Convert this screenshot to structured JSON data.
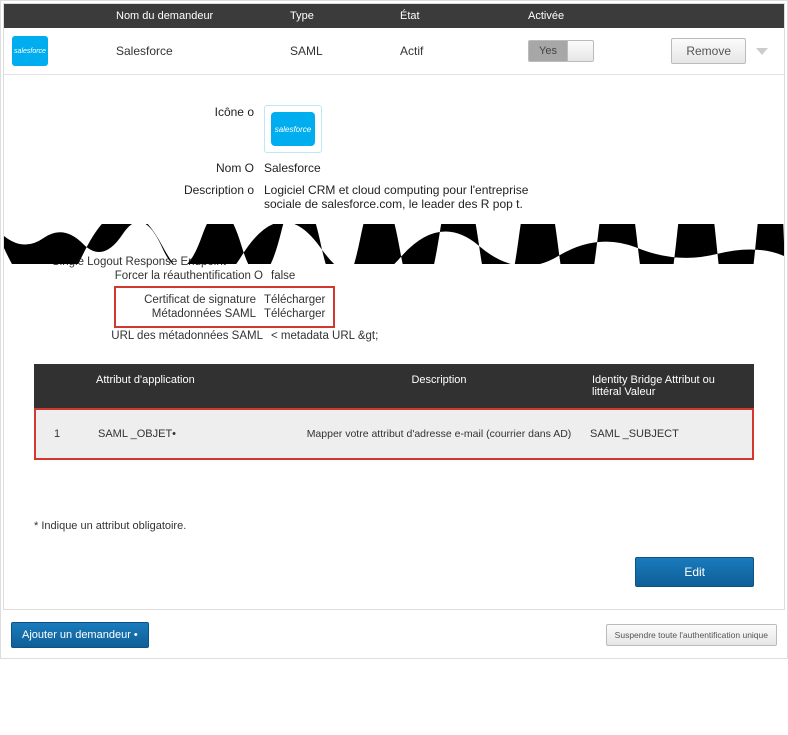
{
  "header": {
    "col_name": "Nom du demandeur",
    "col_type": "Type",
    "col_state": "État",
    "col_active": "Activée"
  },
  "logo_text": "salesforce",
  "row": {
    "name": "Salesforce",
    "type": "SAML",
    "state": "Actif",
    "active_label": "Yes",
    "remove_label": "Remove"
  },
  "details": {
    "icon_label": "Icône o",
    "name_label": "Nom O",
    "name_value": "Salesforce",
    "desc_label": "Description o",
    "desc_value": "Logiciel CRM et cloud computing pour l'entreprise sociale de salesforce.com, le leader des R pop t."
  },
  "post_tear": {
    "slo_label": "Single Logout Response Endpoint",
    "reauth_label": "Forcer la réauthentification O",
    "reauth_value": "false",
    "cert_label": "Certificat de signature",
    "cert_action": "Télécharger",
    "meta_label": "Métadonnées SAML",
    "meta_action": "Télécharger",
    "metaurl_label": "URL des métadonnées SAML",
    "metaurl_value": "< metadata URL &gt;"
  },
  "attr_table": {
    "hdr_app": "Attribut d'application",
    "hdr_desc": "Description",
    "hdr_idb": "Identity Bridge Attribut ou littéral Valeur",
    "row_num": "1",
    "row_app": "SAML _OBJET•",
    "row_desc": "Mapper votre attribut d'adresse e-mail (courrier dans AD)",
    "row_idb": "SAML _SUBJECT"
  },
  "footnote": "* Indique un attribut obligatoire.",
  "buttons": {
    "edit": "Edit",
    "add": "Ajouter un demandeur •",
    "suspend": "Suspendre toute l'authentification unique"
  }
}
